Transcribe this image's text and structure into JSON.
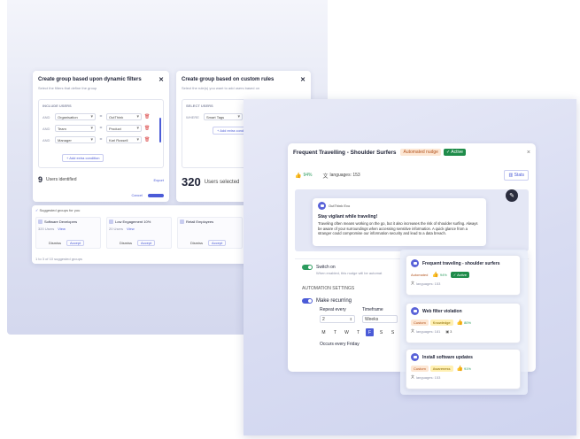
{
  "left": {
    "dynamic": {
      "title": "Create group based upon dynamic filters",
      "subtitle": "Select the filters that define the group",
      "include_label": "INCLUDE USERS",
      "conditions": [
        {
          "op": "AND",
          "field": "Organisation",
          "eq": "=",
          "value": "OutThink"
        },
        {
          "op": "AND",
          "field": "Team",
          "eq": "=",
          "value": "Product"
        },
        {
          "op": "AND",
          "field": "Manager",
          "eq": "=",
          "value": "Karl Russell"
        }
      ],
      "add_condition": "+ Add extra condition",
      "count": "9",
      "count_label": "Users identified",
      "export": "Export",
      "cancel": "Cancel",
      "create": "Create"
    },
    "custom": {
      "title": "Create group based on custom rules",
      "subtitle": "Select the rule(s) you want to add users based on",
      "select_label": "SELECT USERS",
      "rule_op": "WHERE",
      "rule_field": "Smart Tags",
      "add_condition": "+ Add extra condition",
      "count": "320",
      "count_label": "Users selected"
    },
    "suggested": {
      "header": "Suggested groups for you",
      "groups": [
        {
          "name": "Software Developers",
          "users": "320 Users",
          "view": "View",
          "dismiss": "Dismiss",
          "accept": "Accept"
        },
        {
          "name": "Low Engagement 10%",
          "users": "20 Users",
          "view": "View",
          "dismiss": "Dismiss",
          "accept": "Accept"
        },
        {
          "name": "Retail Employees",
          "users": "",
          "view": "",
          "dismiss": "Dismiss",
          "accept": "Accept"
        }
      ],
      "footer": "1 to 3 of 10 suggested groups"
    }
  },
  "nudge": {
    "title": "Frequent Travelling - Shoulder Surfers",
    "type_badge": "Automated nudge",
    "status_badge": "Active",
    "close": "×",
    "approval": "94%",
    "languages": "languages: 153",
    "stats": "Stats",
    "message": {
      "sender": "OutThink Evo",
      "heading": "Stay vigilant while traveling!",
      "body": "Traveling often means working on the go, but it also increases the risk of shoulder surfing. Always be aware of your surroundings when accessing sensitive information. A quick glance from a stranger could compromise our information security and lead to a data breach."
    },
    "switch_title": "Switch on",
    "switch_desc": "When enabled, this nudge will be automat",
    "automation_label": "AUTOMATION SETTINGS",
    "recurring_label": "Make recurring",
    "repeat_label": "Repeat every",
    "repeat_value": "2",
    "timeframe_label": "Timeframe",
    "timeframe_value": "Weeks",
    "days": [
      "M",
      "T",
      "W",
      "T",
      "F",
      "S",
      "S"
    ],
    "selected_day_index": 4,
    "occurs": "Occurs every Friday"
  },
  "list": [
    {
      "title": "Frequent traveling - shoulder surfers",
      "tag1": "Automated",
      "pct": "94%",
      "tag2": "Active",
      "langs": "languages: 153",
      "extra": ""
    },
    {
      "title": "Web filter violation",
      "tag1": "Custom",
      "tag2": "Knowledge",
      "pct": "80%",
      "langs": "languages: 181",
      "extra": "3"
    },
    {
      "title": "Install software updates",
      "tag1": "Custom",
      "tag2": "Awareness",
      "pct": "91%",
      "langs": "languages: 153",
      "extra": ""
    }
  ]
}
